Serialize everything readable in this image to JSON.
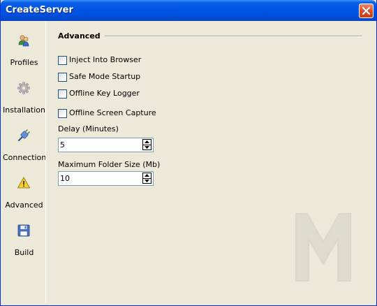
{
  "window": {
    "title": "CreateServer"
  },
  "sidebar": {
    "items": [
      {
        "label": "Profiles",
        "icon": "profiles-icon"
      },
      {
        "label": "Installation",
        "icon": "gear-icon"
      },
      {
        "label": "Connection",
        "icon": "plug-icon"
      },
      {
        "label": "Advanced",
        "icon": "warning-icon"
      },
      {
        "label": "Build",
        "icon": "floppy-disk-icon"
      }
    ],
    "selected": "Advanced"
  },
  "main": {
    "section_title": "Advanced",
    "checkboxes": [
      {
        "label": "Inject Into Browser",
        "checked": false
      },
      {
        "label": "Safe Mode Startup",
        "checked": false
      },
      {
        "label": "Offline Key Logger",
        "checked": false
      },
      {
        "label": "Offline Screen Capture",
        "checked": false
      }
    ],
    "delay": {
      "label": "Delay (Minutes)",
      "value": "5"
    },
    "max_folder_size": {
      "label": "Maximum Folder Size (Mb)",
      "value": "10"
    }
  },
  "colors": {
    "titlebar": "#0054e3",
    "window_bg": "#ece9d8",
    "close_button": "#d6502b"
  }
}
